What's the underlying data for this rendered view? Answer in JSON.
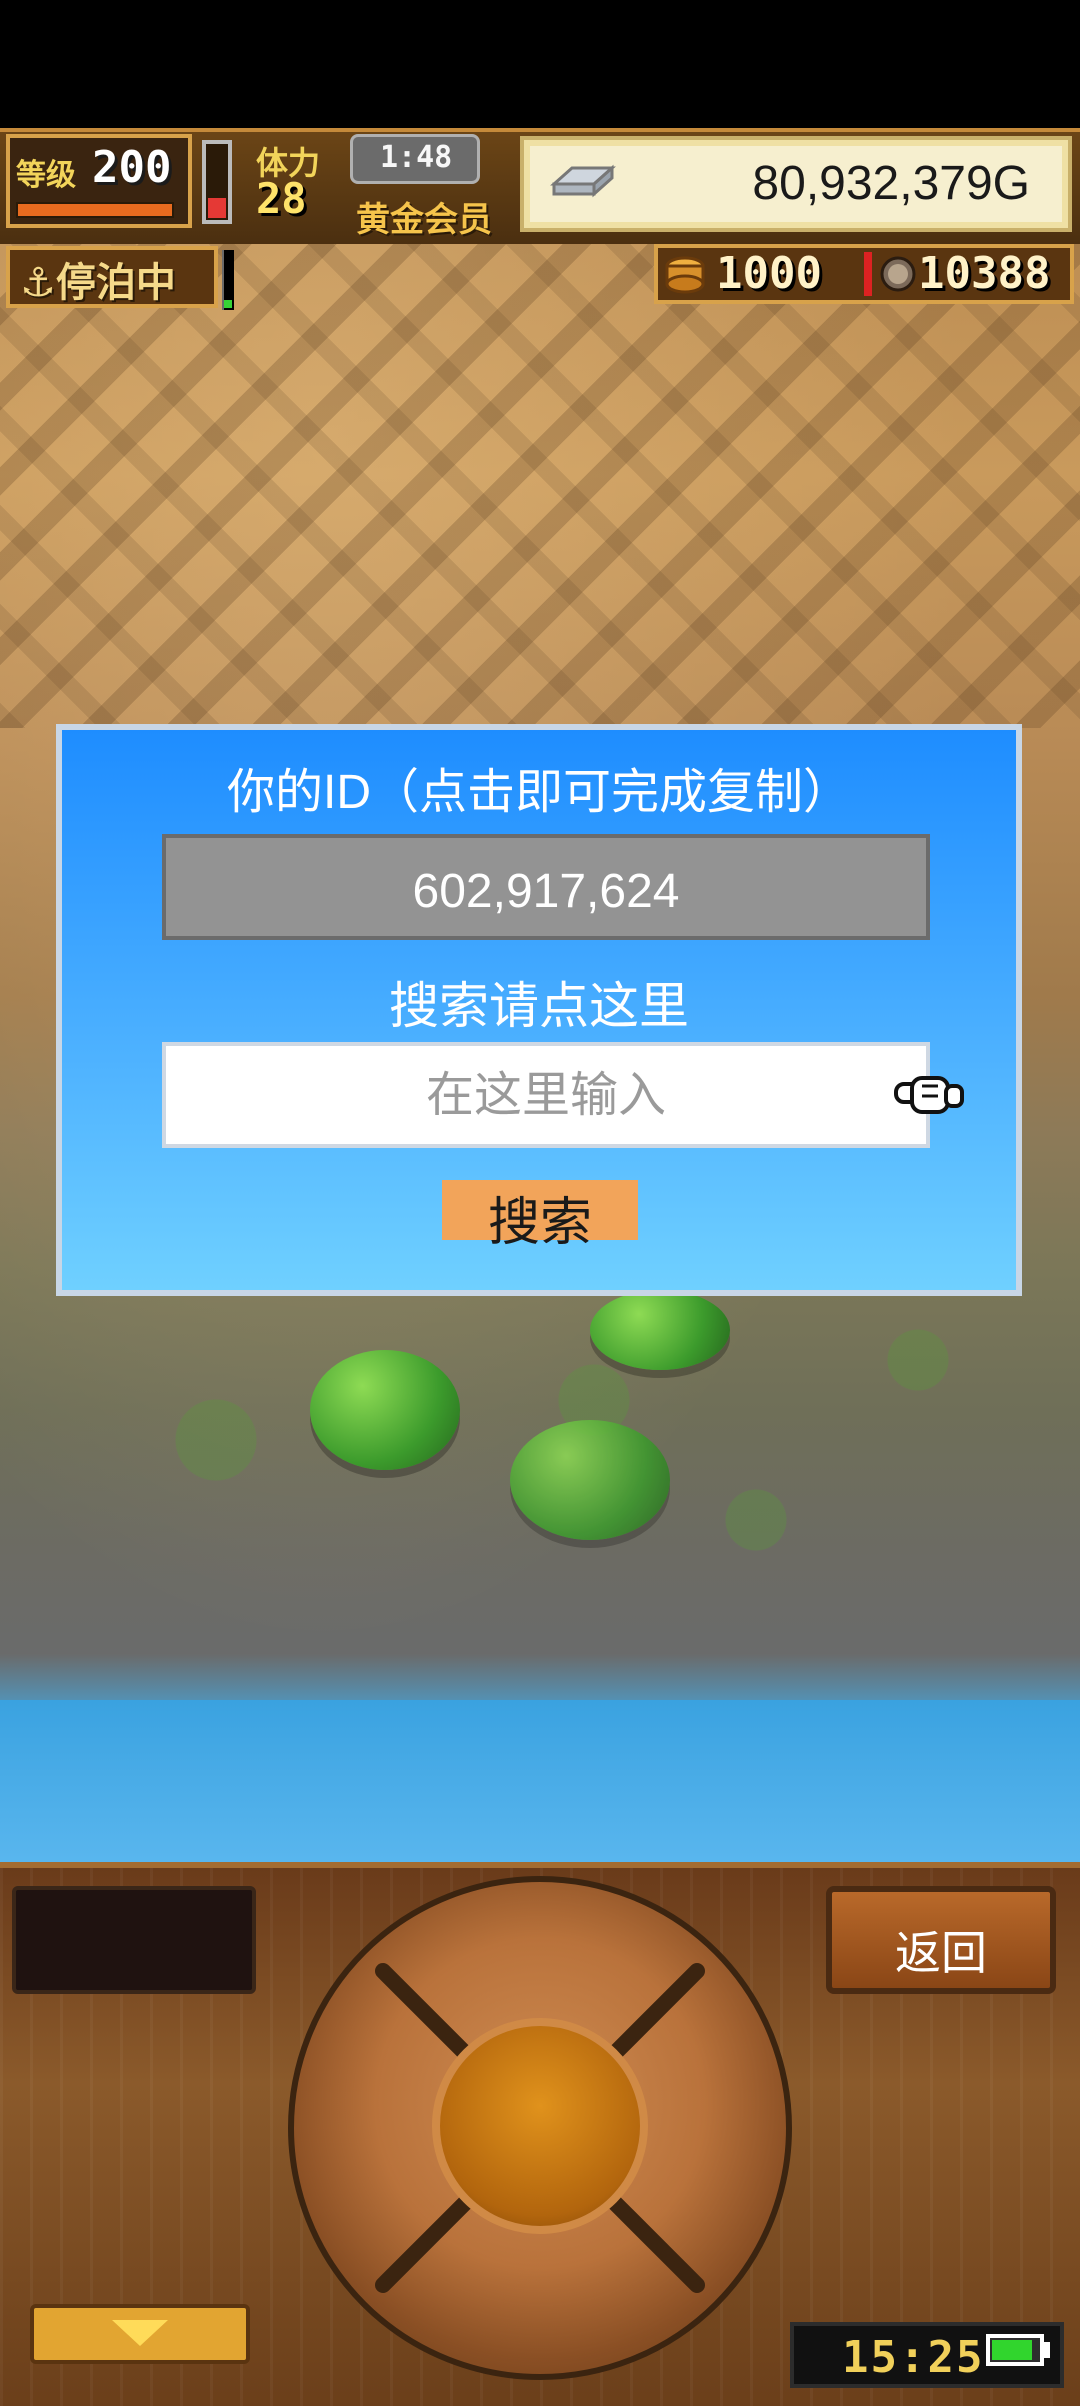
{
  "hud": {
    "level": {
      "label": "等级",
      "value": "200"
    },
    "stamina": {
      "label": "体力",
      "value": "28"
    },
    "time": "1:48",
    "membership": "黄金会员",
    "money": "80,932,379G",
    "status_badge": "停泊中",
    "resources": [
      {
        "icon": "coin-stack-icon",
        "value": "1000"
      },
      {
        "icon": "medal-icon",
        "value": "10388"
      }
    ]
  },
  "dialog": {
    "title": "你的ID（点击即可完成复制）",
    "id_value": "602,917,624",
    "search_title": "搜索请点这里",
    "search_placeholder": "在这里输入",
    "search_button_label": "搜索",
    "hand_icon": "pointing-hand-icon"
  },
  "controls": {
    "back_button_label": "返回",
    "down_button_icon": "down-arrow-icon"
  },
  "device": {
    "clock": "15:25",
    "battery_icon": "battery-icon"
  },
  "colors": {
    "dialog_top": "#1e8dff",
    "dialog_bottom": "#6fd0ff",
    "search_button": "#f2a45a",
    "id_box": "#939393",
    "hud_gold": "#f2d45a"
  }
}
